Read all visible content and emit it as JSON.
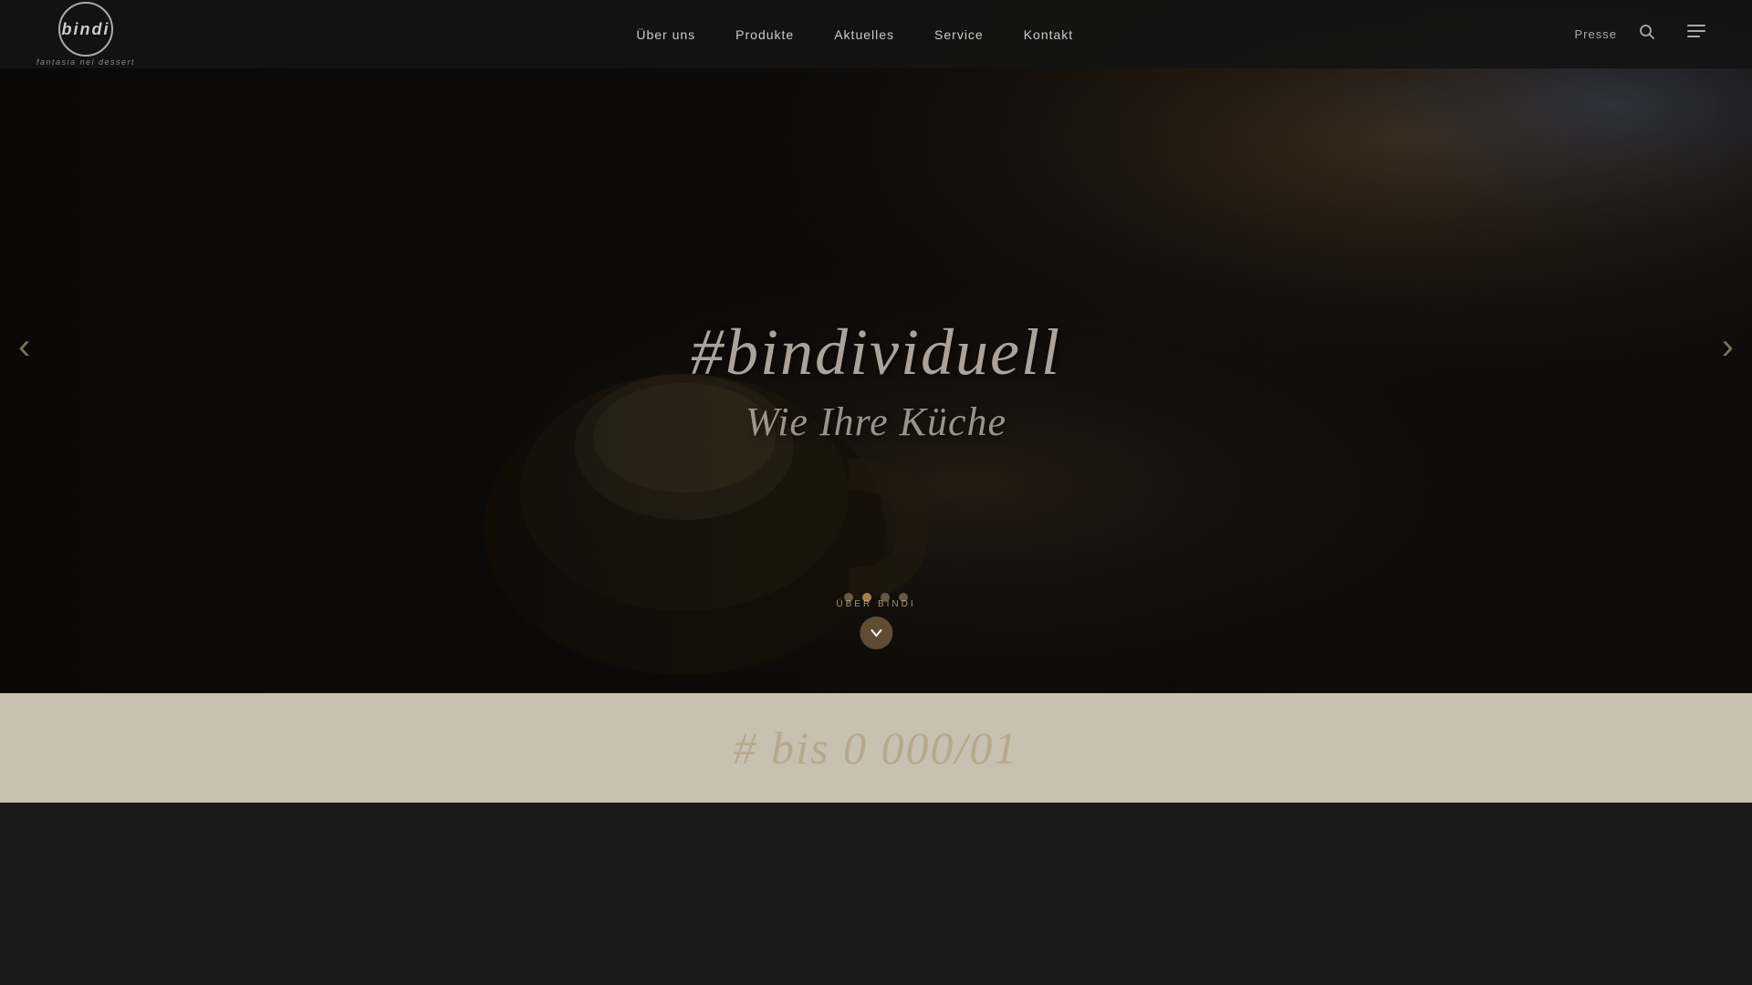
{
  "header": {
    "logo": {
      "brand": "bindi",
      "tagline": "fantasia nel dessert"
    },
    "top_right": {
      "presse_label": "Presse"
    },
    "nav": {
      "items": [
        {
          "id": "uber-uns",
          "label": "Über uns"
        },
        {
          "id": "produkte",
          "label": "Produkte"
        },
        {
          "id": "aktuelles",
          "label": "Aktuelles"
        },
        {
          "id": "service",
          "label": "Service"
        },
        {
          "id": "kontakt",
          "label": "Kontakt"
        }
      ]
    }
  },
  "hero": {
    "headline": "#bindividuell",
    "subheadline": "Wie Ihre Küche",
    "dots": [
      {
        "id": 1,
        "active": false
      },
      {
        "id": 2,
        "active": true
      },
      {
        "id": 3,
        "active": false
      },
      {
        "id": 4,
        "active": false
      }
    ],
    "uber_bindi_label": "ÜBER BINDI",
    "scroll_down_symbol": "❯",
    "prev_arrow": "‹",
    "next_arrow": "›"
  },
  "bottom": {
    "partial_text": "# bis 0 000/01"
  }
}
